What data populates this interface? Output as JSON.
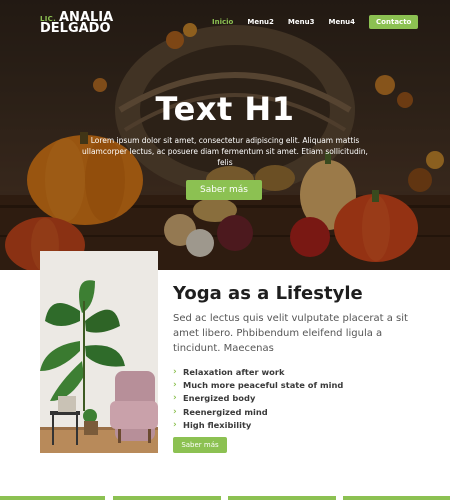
{
  "logo": {
    "prefix": "LIC.",
    "line1": "ANALIA",
    "line2": "DELGADO"
  },
  "nav": {
    "items": [
      {
        "label": "Inicio",
        "active": true
      },
      {
        "label": "Menu2",
        "active": false
      },
      {
        "label": "Menu3",
        "active": false
      },
      {
        "label": "Menu4",
        "active": false
      }
    ],
    "contact_label": "Contacto"
  },
  "hero": {
    "title": "Text H1",
    "text": "Lorem ipsum dolor sit amet, consectetur adipiscing elit. Aliquam mattis ullamcorper lectus, ac posuere diam fermentum sit amet. Etiam sollicitudin, felis",
    "button_label": "Saber más"
  },
  "section": {
    "title": "Yoga as a Lifestyle",
    "description": "Sed ac lectus quis velit vulputate placerat a sit amet libero. Phbibendum eleifend ligula a tincidunt. Maecenas",
    "features": [
      "Relaxation after work",
      "Much more peaceful state of mind",
      "Energized body",
      "Reenergized mind",
      "High flexibility"
    ],
    "button_label": "Saber más"
  },
  "colors": {
    "accent": "#8cc152",
    "text_dark": "#1e1e1e",
    "text_body": "#555555"
  },
  "icons": {
    "feature_bullet": "chevron-right-icon"
  }
}
